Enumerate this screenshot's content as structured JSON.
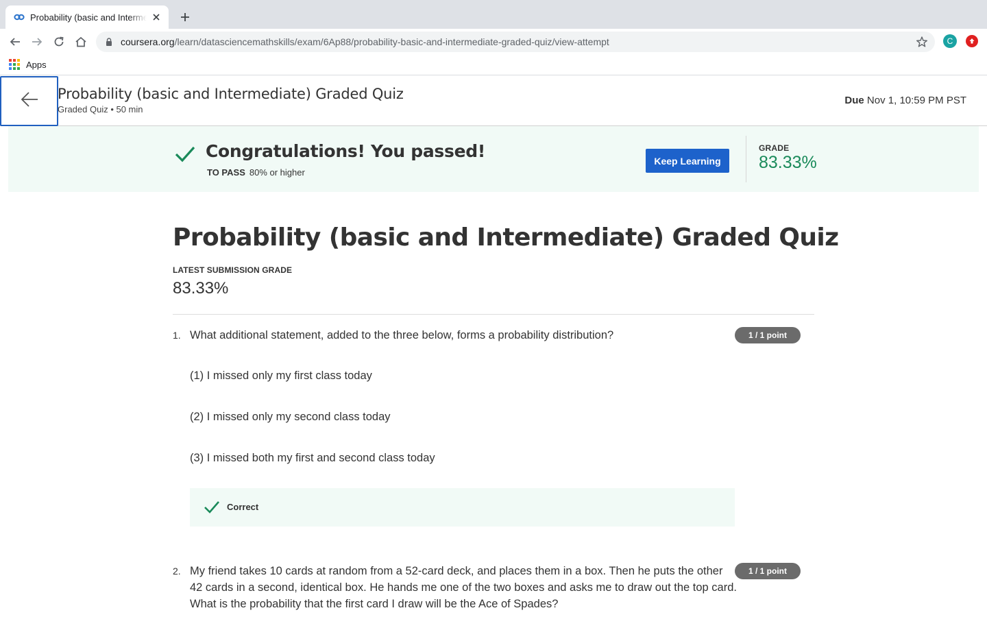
{
  "browser": {
    "tab_title": "Probability (basic and Intermediate) Graded Quiz | Coursera",
    "url_host": "coursera.org",
    "url_path": "/learn/datasciencemathskills/exam/6Ap88/probability-basic-and-intermediate-graded-quiz/view-attempt",
    "profile_initial": "C",
    "bookmarks_apps_label": "Apps"
  },
  "header": {
    "title": "Probability (basic and Intermediate) Graded Quiz",
    "subtitle": "Graded Quiz • 50 min",
    "due_label": "Due",
    "due_value": "Nov 1, 10:59 PM PST"
  },
  "banner": {
    "message": "Congratulations! You passed!",
    "to_pass_label": "TO PASS",
    "to_pass_value": "80% or higher",
    "button_label": "Keep Learning",
    "grade_label": "GRADE",
    "grade_value": "83.33%"
  },
  "main": {
    "title": "Probability (basic and Intermediate) Graded Quiz",
    "latest_label": "LATEST SUBMISSION GRADE",
    "latest_value": "83.33%"
  },
  "questions": [
    {
      "number": "1.",
      "text": "What additional statement, added to the three below, forms a probability distribution?",
      "points": "1 / 1 point",
      "statements": [
        "(1) I missed only my first class today",
        "(2) I missed only my second class today",
        "(3) I missed both my first and second class today"
      ],
      "feedback": "Correct"
    },
    {
      "number": "2.",
      "text": "My friend takes 10 cards at random from a 52-card deck, and places them in a box. Then he puts the other 42 cards in a second, identical box. He hands me one of the two boxes and asks me to draw out the top card. What is the probability that the first card I draw will be the Ace of Spades?",
      "points": "1 / 1 point"
    }
  ],
  "colors": {
    "accent_blue": "#1d62cb",
    "success_green": "#1a8a5a",
    "banner_bg": "#f1faf6",
    "points_badge": "#6b6b6b"
  }
}
